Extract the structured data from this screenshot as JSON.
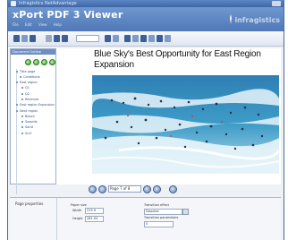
{
  "window": {
    "title": "Infragistics NetAdvantage"
  },
  "app": {
    "name": "xPort PDF 3 Viewer",
    "menu": [
      "File",
      "Edit",
      "View",
      "Help"
    ],
    "brand": "infragistics"
  },
  "toolbar": {
    "page_box": "Page 7 of 8"
  },
  "sidebar": {
    "header": "Document Outline",
    "tree": [
      "Title page",
      "Conditions",
      "East region",
      "Q1",
      "Q2",
      "Revenue",
      "East region Expansion",
      "Next region",
      "Beach",
      "Seaside",
      "Sand",
      "Surf"
    ]
  },
  "document": {
    "title": "Blue Sky's Best Opportunity for East Region Expansion"
  },
  "pager": {
    "page": "Page 7 of 8"
  },
  "properties": {
    "title": "Page properties",
    "paper_size_label": "Paper size",
    "width_label": "Width",
    "width_value": "215.9",
    "height_label": "Height",
    "height_value": "281.94",
    "transition_label": "Transition effect",
    "transition_value": "Dissolve",
    "transition_param_label": "Transition parameters",
    "transition_param_value": "0"
  }
}
